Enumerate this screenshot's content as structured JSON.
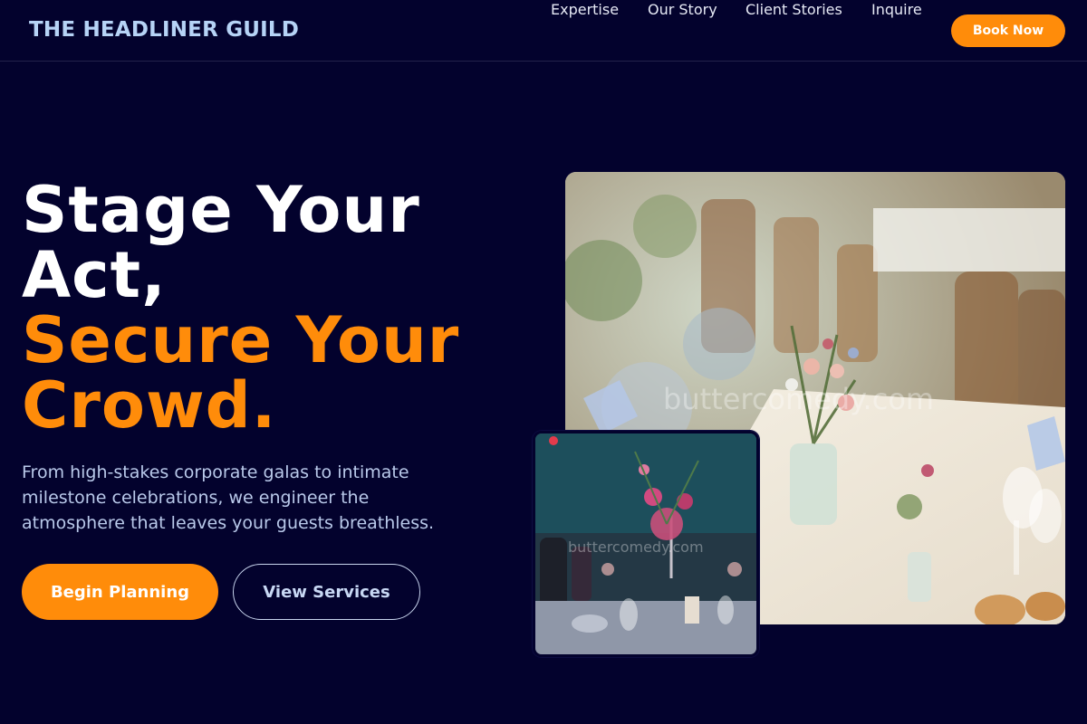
{
  "header": {
    "logo": "THE HEADLINER GUILD",
    "nav": [
      {
        "label": "Expertise"
      },
      {
        "label": "Our Story"
      },
      {
        "label": "Client Stories"
      },
      {
        "label": "Inquire"
      }
    ],
    "cta": "Book Now"
  },
  "hero": {
    "title_line1": "Stage Your",
    "title_line2": "Act,",
    "title_line3": "Secure Your",
    "title_line4": "Crowd.",
    "subtitle": "From high-stakes corporate galas to intimate milestone celebrations, we engineer the atmosphere that leaves your guests breathless.",
    "primary_button": "Begin Planning",
    "secondary_button": "View Services"
  },
  "images": {
    "main_watermark": "buttercomedy.com",
    "inset_watermark": "buttercomedy.com"
  },
  "colors": {
    "background": "#03022d",
    "accent": "#ff8c0a",
    "logo": "#b6d3f6",
    "subtitle": "#b9c9ea"
  }
}
